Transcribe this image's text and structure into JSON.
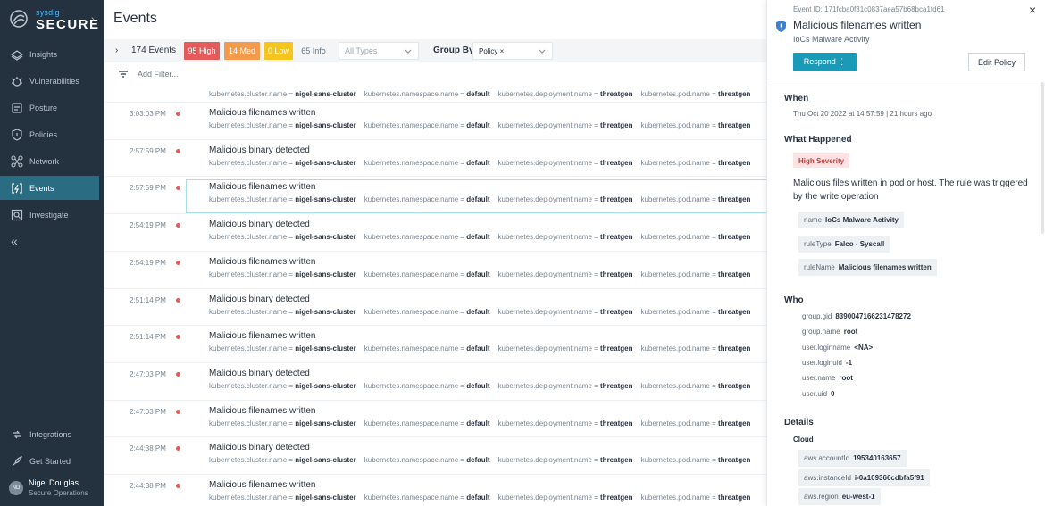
{
  "sidebar": {
    "logo_small": "sysdig",
    "logo_big": "SECURE",
    "logo_chevron": "›",
    "items": [
      {
        "label": "Insights",
        "icon": "insights-icon"
      },
      {
        "label": "Vulnerabilities",
        "icon": "vulnerabilities-icon"
      },
      {
        "label": "Posture",
        "icon": "posture-icon"
      },
      {
        "label": "Policies",
        "icon": "policies-icon"
      },
      {
        "label": "Network",
        "icon": "network-icon"
      },
      {
        "label": "Events",
        "icon": "events-icon",
        "active": true
      },
      {
        "label": "Investigate",
        "icon": "investigate-icon"
      }
    ],
    "collapse": "«",
    "bottom_items": [
      {
        "label": "Integrations",
        "icon": "integrations-icon"
      },
      {
        "label": "Get Started",
        "icon": "get-started-icon"
      }
    ],
    "user": {
      "initials": "ND",
      "name": "Nigel Douglas",
      "role": "Secure Operations"
    }
  },
  "main": {
    "title": "Events",
    "toolbar": {
      "chevron": "›",
      "count": "174 Events",
      "high": "95 High",
      "med": "14 Med",
      "low": "0 Low",
      "info": "65 Info",
      "type_placeholder": "All Types",
      "group_by_label": "Group By",
      "group_by_value": "Policy ×"
    },
    "filter_placeholder": "Add Filter..."
  },
  "tags": {
    "cluster_key": "kubernetes.cluster.name = ",
    "cluster_val": "nigel-sans-cluster",
    "ns_key": "kubernetes.namespace.name = ",
    "ns_val": "default",
    "deploy_key": "kubernetes.deployment.name = ",
    "deploy_val": "threatgen",
    "pod_key": "kubernetes.pod.name = ",
    "pod_val": "threatgen"
  },
  "events": [
    {
      "time": "3:03:03 PM",
      "title": "Malicious filenames written"
    },
    {
      "time": "2:57:59 PM",
      "title": "Malicious binary detected"
    },
    {
      "time": "2:57:59 PM",
      "title": "Malicious filenames written",
      "selected": true
    },
    {
      "time": "2:54:19 PM",
      "title": "Malicious binary detected"
    },
    {
      "time": "2:54:19 PM",
      "title": "Malicious filenames written"
    },
    {
      "time": "2:51:14 PM",
      "title": "Malicious binary detected"
    },
    {
      "time": "2:51:14 PM",
      "title": "Malicious filenames written"
    },
    {
      "time": "2:47:03 PM",
      "title": "Malicious binary detected"
    },
    {
      "time": "2:47:03 PM",
      "title": "Malicious filenames written"
    },
    {
      "time": "2:44:38 PM",
      "title": "Malicious binary detected"
    },
    {
      "time": "2:44:38 PM",
      "title": "Malicious filenames written"
    }
  ],
  "panel": {
    "event_id": "Event ID: 171fcba0f31c0837aea57b68bca1fd61",
    "close": "×",
    "title": "Malicious filenames written",
    "subtitle": "IoCs Malware Activity",
    "respond": "Respond  ⋮",
    "edit_policy": "Edit Policy",
    "when_label": "When",
    "when_value": "Thu Oct 20 2022 at 14:57:59 | 21 hours ago",
    "what_label": "What Happened",
    "severity": "High Severity",
    "description": "Malicious files written in pod or host. The rule was triggered by the write operation",
    "rule_chips": [
      {
        "k": "name",
        "v": "IoCs Malware Activity"
      },
      {
        "k": "ruleType",
        "v": "Falco - Syscall"
      },
      {
        "k": "ruleName",
        "v": "Malicious filenames written"
      }
    ],
    "who_label": "Who",
    "who": [
      {
        "k": "group.gid",
        "v": "8390047166231478272"
      },
      {
        "k": "group.name",
        "v": "root"
      },
      {
        "k": "user.loginname",
        "v": "<NA>"
      },
      {
        "k": "user.loginuid",
        "v": "-1"
      },
      {
        "k": "user.name",
        "v": "root"
      },
      {
        "k": "user.uid",
        "v": "0"
      }
    ],
    "details_label": "Details",
    "cloud_label": "Cloud",
    "cloud": [
      {
        "k": "aws.accountId",
        "v": "195340163657"
      },
      {
        "k": "aws.instanceId",
        "v": "i-0a109366cdbfa5f91"
      },
      {
        "k": "aws.region",
        "v": "eu-west-1"
      }
    ]
  },
  "colors": {
    "sidebar_bg": "#24323f",
    "active_nav": "#2a6d83",
    "high": "#e35b5b",
    "med": "#f29b4c",
    "low": "#f5c51d",
    "accent": "#1b9ab8"
  }
}
